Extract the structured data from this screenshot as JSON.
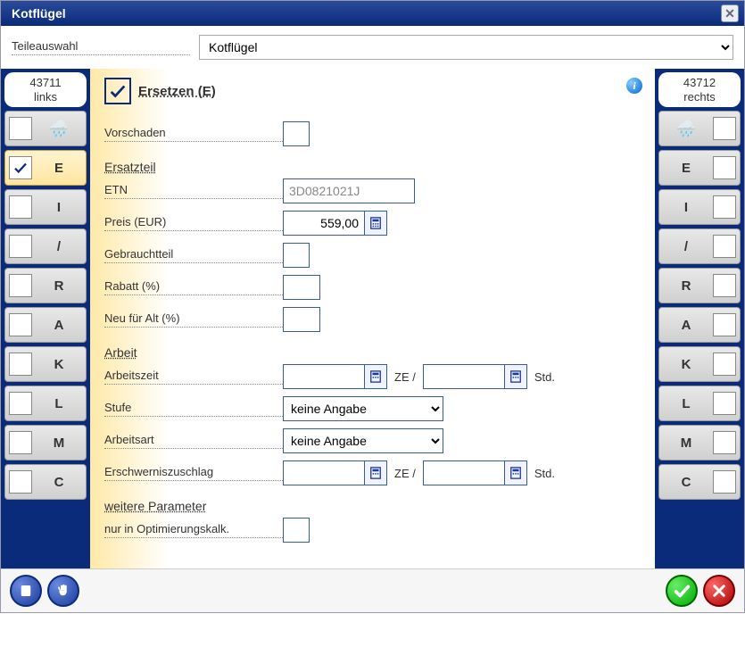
{
  "title": "Kotflügel",
  "selection": {
    "label": "Teileauswahl",
    "value": "Kotflügel"
  },
  "left_col": {
    "part_id": "43711",
    "side": "links",
    "rows": [
      {
        "key": "weather",
        "label": "",
        "selected": false
      },
      {
        "key": "E",
        "label": "E",
        "selected": true
      },
      {
        "key": "I",
        "label": "I",
        "selected": false
      },
      {
        "key": "slash",
        "label": "/",
        "selected": false
      },
      {
        "key": "R",
        "label": "R",
        "selected": false
      },
      {
        "key": "A",
        "label": "A",
        "selected": false
      },
      {
        "key": "K",
        "label": "K",
        "selected": false
      },
      {
        "key": "L",
        "label": "L",
        "selected": false
      },
      {
        "key": "M",
        "label": "M",
        "selected": false
      },
      {
        "key": "C",
        "label": "C",
        "selected": false
      }
    ]
  },
  "right_col": {
    "part_id": "43712",
    "side": "rechts",
    "rows": [
      {
        "key": "weather",
        "label": "",
        "selected": false
      },
      {
        "key": "E",
        "label": "E",
        "selected": false
      },
      {
        "key": "I",
        "label": "I",
        "selected": false
      },
      {
        "key": "slash",
        "label": "/",
        "selected": false
      },
      {
        "key": "R",
        "label": "R",
        "selected": false
      },
      {
        "key": "A",
        "label": "A",
        "selected": false
      },
      {
        "key": "K",
        "label": "K",
        "selected": false
      },
      {
        "key": "L",
        "label": "L",
        "selected": false
      },
      {
        "key": "M",
        "label": "M",
        "selected": false
      },
      {
        "key": "C",
        "label": "C",
        "selected": false
      }
    ]
  },
  "form": {
    "heading": "Ersetzen (E)",
    "vorschaden_label": "Vorschaden",
    "vorschaden": "",
    "ersatzteil_section": "Ersatzteil",
    "etn_label": "ETN",
    "etn": "3D0821021J",
    "preis_label": "Preis (EUR)",
    "preis": "559,00",
    "gebrauchtteil_label": "Gebrauchtteil",
    "gebrauchtteil": "",
    "rabatt_label": "Rabatt (%)",
    "rabatt": "",
    "neu_fuer_alt_label": "Neu für Alt (%)",
    "neu_fuer_alt": "",
    "arbeit_section": "Arbeit",
    "arbeitszeit_label": "Arbeitszeit",
    "arbeitszeit_ze": "",
    "arbeitszeit_std": "",
    "ze_sep": "ZE /",
    "std_unit": "Std.",
    "stufe_label": "Stufe",
    "stufe": "keine Angabe",
    "arbeitsart_label": "Arbeitsart",
    "arbeitsart": "keine Angabe",
    "erschwernis_label": "Erschwerniszuschlag",
    "erschwernis_ze": "",
    "erschwernis_std": "",
    "weitere_section": "weitere Parameter",
    "nur_opt_label": "nur in Optimierungskalk.",
    "nur_opt": ""
  }
}
